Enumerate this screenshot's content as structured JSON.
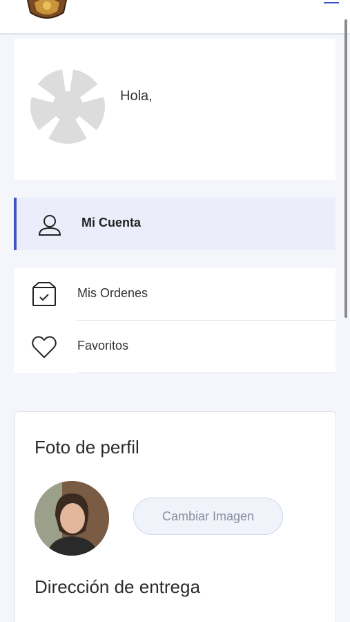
{
  "header": {
    "logo_icon": "shield-logo-icon",
    "menu_icon": "hamburger-menu-icon",
    "accent": "#3d55c9"
  },
  "profile": {
    "greeting": "Hola,"
  },
  "nav": {
    "active": {
      "label": "Mi Cuenta",
      "icon": "user-icon"
    },
    "items": [
      {
        "label": "Mis Ordenes",
        "icon": "box-check-icon"
      },
      {
        "label": "Favoritos",
        "icon": "heart-icon"
      }
    ]
  },
  "profile_card": {
    "photo_title": "Foto de perfil",
    "change_image_label": "Cambiar Imagen",
    "address_title": "Dirección de entrega"
  }
}
